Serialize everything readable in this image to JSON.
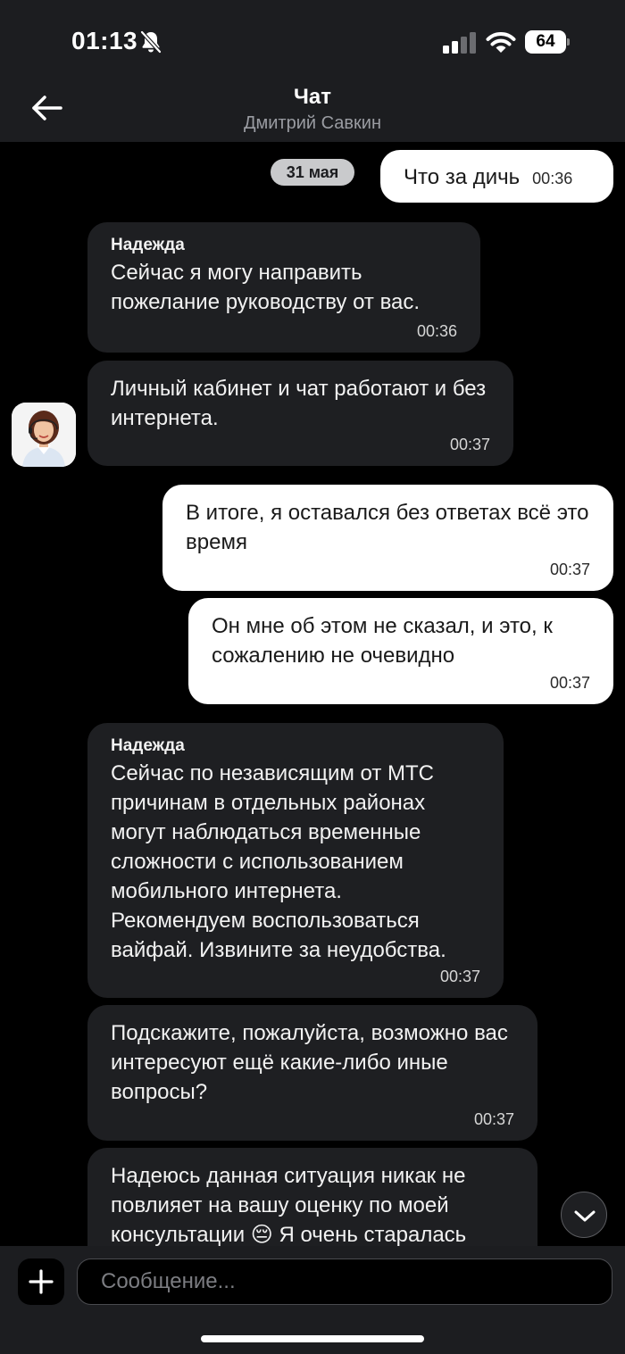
{
  "status_bar": {
    "time": "01:13",
    "battery_level": "64",
    "icons": [
      "bell-slash-icon",
      "signal-icon",
      "wifi-icon",
      "battery-icon"
    ]
  },
  "header": {
    "title": "Чат",
    "subtitle": "Дмитрий Савкин",
    "back_icon": "arrow-left-icon"
  },
  "chat": {
    "date_chip": "31 мая",
    "messages": [
      {
        "direction": "out",
        "text": "Что за дичь",
        "time": "00:36"
      },
      {
        "direction": "in",
        "sender": "Надежда",
        "text": "Сейчас я могу направить пожелание руководству от вас.",
        "time": "00:36"
      },
      {
        "direction": "in",
        "text": "Личный кабинет и чат работают и без интернета.",
        "time": "00:37"
      },
      {
        "direction": "out",
        "text": "В итоге, я оставался без ответах всё это время",
        "time": "00:37"
      },
      {
        "direction": "out",
        "text": "Он мне об этом не сказал, и это, к сожалению не очевидно",
        "time": "00:37"
      },
      {
        "direction": "in",
        "sender": "Надежда",
        "text": "Сейчас по независящим от МТС причинам в отдельных районах могут наблюдаться временные сложности с использованием мобильного интернета. Рекомендуем воспользоваться вайфай. Извините за неудобства.",
        "time": "00:37"
      },
      {
        "direction": "in",
        "text": "Подскажите, пожалуйста, возможно вас интересуют ещё какие-либо иные вопросы?",
        "time": "00:37"
      },
      {
        "direction": "in",
        "text": "Надеюсь данная ситуация никак не повлияет на вашу оценку по моей консультации 😔 Я очень старалась",
        "time": ""
      }
    ]
  },
  "composer": {
    "placeholder": "Сообщение...",
    "value": ""
  },
  "colors": {
    "background": "#000000",
    "header_bg": "#1c1d20",
    "incoming_bubble": "#1e1f22",
    "outgoing_bubble": "#ffffff",
    "date_chip": "#c9cacc"
  }
}
